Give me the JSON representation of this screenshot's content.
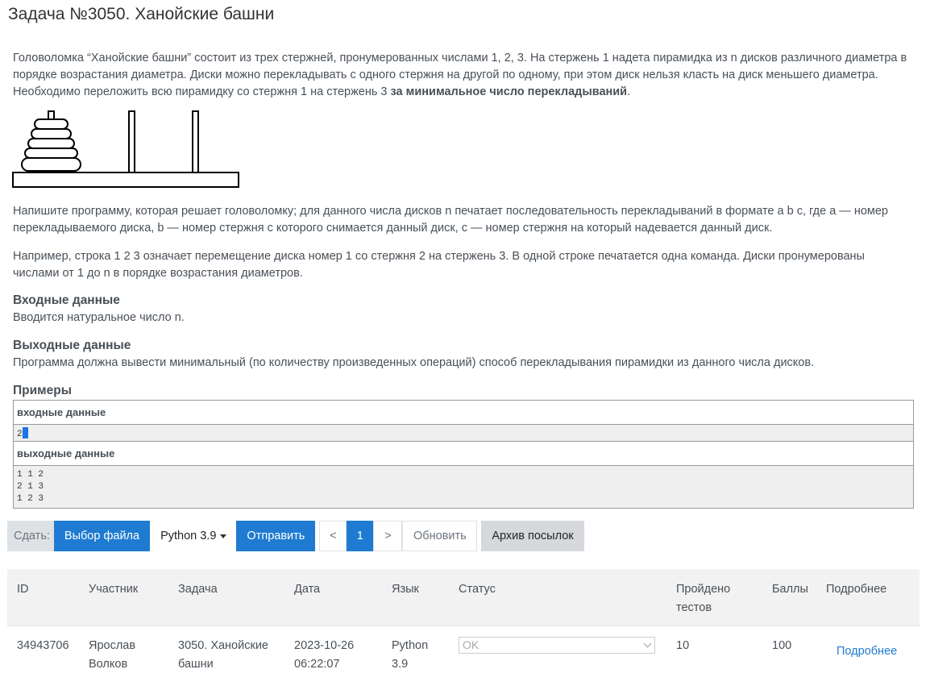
{
  "problem": {
    "title": "Задача №3050. Ханойские башни",
    "para1": "Головоломка “Ханойские башни” состоит из трех стержней, пронумерованных числами 1, 2, 3. На стержень 1 надета пирамидка из n дисков различного диаметра в порядке возрастания диаметра. Диски можно перекладывать с одного стержня на другой по одному, при этом диск нельзя класть на диск меньшего диаметра. Необходимо переложить всю пирамидку со стержня 1 на стержень 3 ",
    "para1_bold": "за минимальное число перекладываний",
    "para1_end": ".",
    "para2": "Напишите программу, которая решает головоломку; для данного числа дисков n печатает последовательность перекладываний в формате a b c, где a — номер перекладываемого диска, b — номер стержня с которого снимается данный диск, c — номер стержня на который надевается данный диск.",
    "para3": "Например, строка 1 2 3 означает перемещение диска номер 1 со стержня 2 на стержень 3. В одной строке печатается одна команда. Диски пронумерованы числами от 1 до n в порядке возрастания диаметров.",
    "input_heading": "Входные данные",
    "input_text": "Вводится натуральное число n.",
    "output_heading": "Выходные данные",
    "output_text": "Программа должна вывести минимальный (по количеству произведенных операций) способ перекладывания пирамидки из данного числа дисков.",
    "examples_heading": "Примеры",
    "example_input_label": "входные данные",
    "example_input": "2",
    "example_output_label": "выходные данные",
    "example_output": "1 1 2\n2 1 3\n1 2 3"
  },
  "submit_bar": {
    "label": "Сдать:",
    "file_button": "Выбор файла",
    "language": "Python 3.9",
    "send_button": "Отправить",
    "prev": "<",
    "page": "1",
    "next": ">",
    "refresh": "Обновить",
    "archive": "Архив посылок"
  },
  "submissions": {
    "headers": {
      "id": "ID",
      "participant": "Участник",
      "task": "Задача",
      "date": "Дата",
      "language": "Язык",
      "status": "Статус",
      "passed_1": "Пройдено",
      "passed_2": "тестов",
      "score": "Баллы",
      "details": "Подробнее"
    },
    "row": {
      "id": "34943706",
      "participant_1": "Ярослав",
      "participant_2": "Волков",
      "task_1": "3050. Ханойские",
      "task_2": "башни",
      "date_1": "2023-10-26",
      "date_2": "06:22:07",
      "language_1": "Python",
      "language_2": "3.9",
      "status": "OK",
      "passed": "10",
      "score": "100",
      "details": "Подробнее"
    }
  },
  "colors": {
    "accent": "#1f7bd1",
    "text": "#495057",
    "header_bg": "#f2f2f2"
  }
}
